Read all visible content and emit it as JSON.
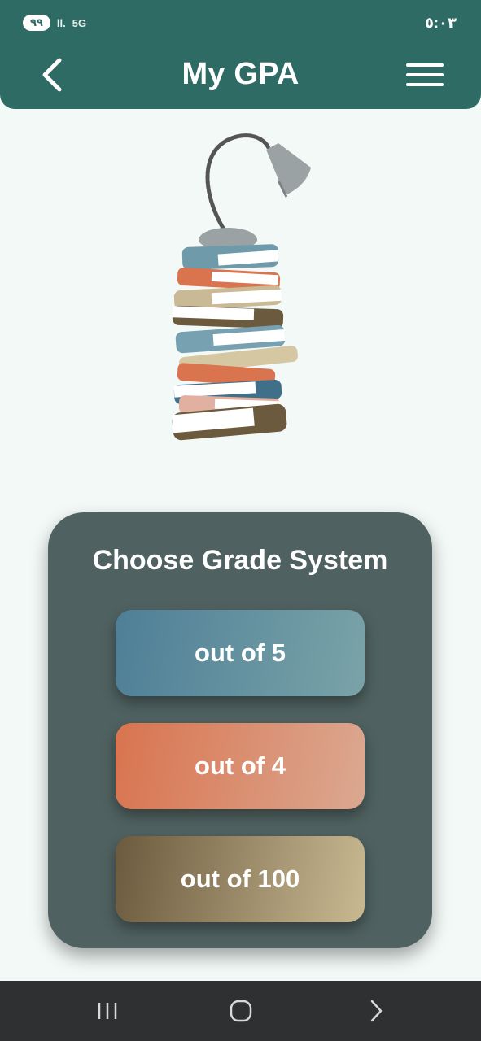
{
  "status_bar": {
    "battery": "٩٩",
    "signal": "ll.",
    "network": "5G",
    "time": "٥:٠٣"
  },
  "app_bar": {
    "title": "My GPA",
    "back_icon": "chevron-left-icon",
    "menu_icon": "hamburger-menu-icon"
  },
  "card": {
    "title": "Choose Grade System",
    "options": [
      {
        "label": "out of 5",
        "color_start": "#4e7f97",
        "color_end": "#7aa3a8"
      },
      {
        "label": "out of 4",
        "color_start": "#d9744f",
        "color_end": "#dba891"
      },
      {
        "label": "out of 100",
        "color_start": "#6c5a3e",
        "color_end": "#c8b992"
      }
    ]
  },
  "nav_bar": {
    "recents_icon": "recents-icon",
    "home_icon": "home-icon",
    "back_icon": "back-icon"
  },
  "colors": {
    "primary": "#2e6b65",
    "background": "#f3f9f7",
    "card": "#4f6160",
    "navbar": "#2f3032"
  }
}
